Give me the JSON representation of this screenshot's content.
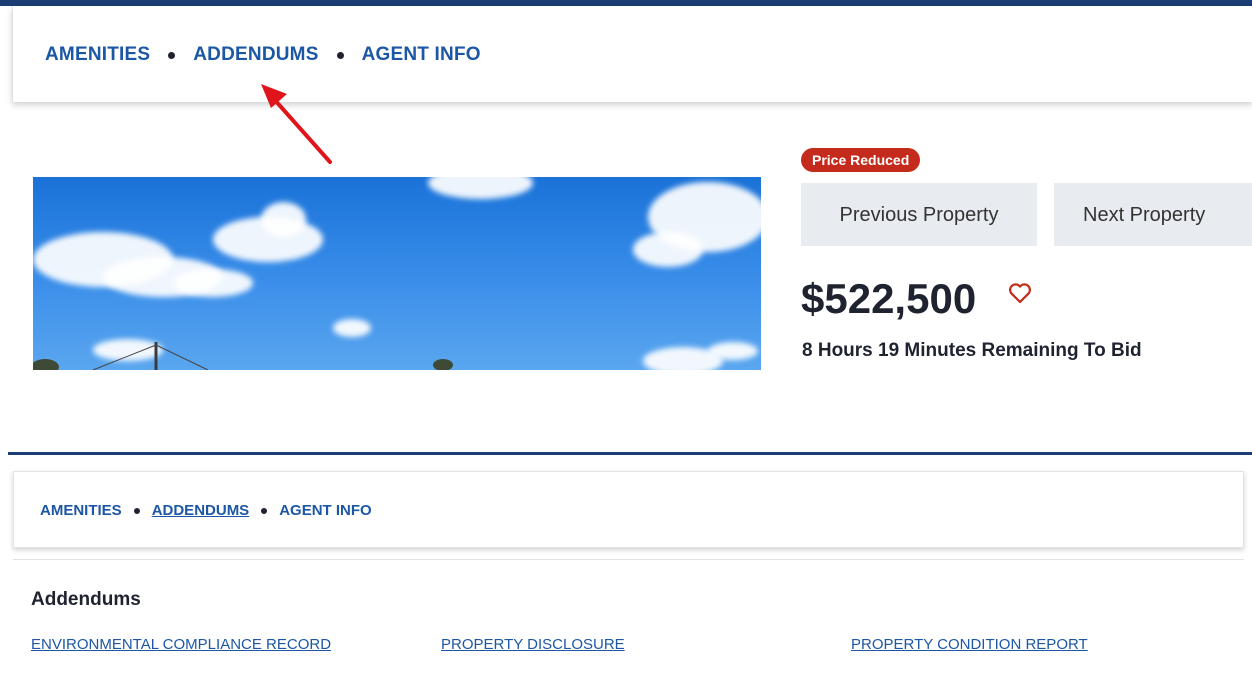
{
  "top": {
    "nav": [
      "AMENITIES",
      "ADDENDUMS",
      "AGENT INFO"
    ],
    "badge": "Price Reduced",
    "prev_label": "Previous Property",
    "next_label": "Next Property",
    "price": "$522,500",
    "remaining": "8 Hours 19 Minutes Remaining To Bid",
    "icons": {
      "favorite": "heart-outline-icon",
      "annotation": "red-arrow"
    },
    "colors": {
      "accent": "#1c57a5",
      "border": "#1a3e74",
      "badge": "#c42b1c",
      "heart": "#c42b1c"
    }
  },
  "bottom": {
    "nav": [
      "AMENITIES",
      "ADDENDUMS",
      "AGENT INFO"
    ],
    "active_nav": "ADDENDUMS",
    "section_title": "Addendums",
    "addenda": [
      "ENVIRONMENTAL COMPLIANCE RECORD",
      "PROPERTY DISCLOSURE",
      "PROPERTY CONDITION REPORT"
    ]
  }
}
